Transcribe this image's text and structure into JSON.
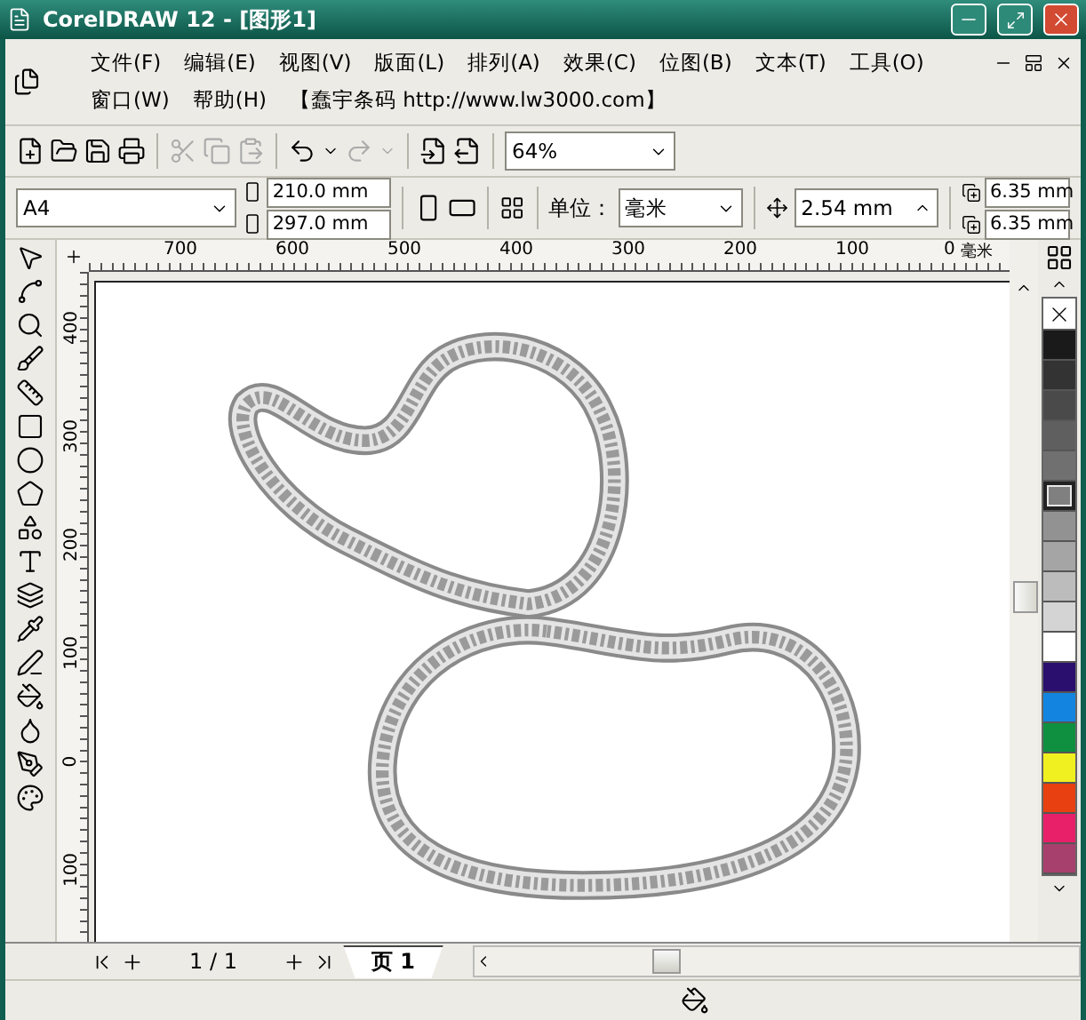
{
  "window": {
    "title": "CorelDRAW 12 - [图形1]"
  },
  "menu": {
    "rows": [
      [
        "文件(F)",
        "编辑(E)",
        "视图(V)",
        "版面(L)",
        "排列(A)",
        "效果(C)",
        "位图(B)",
        "文本(T)",
        "工具(O)"
      ],
      [
        "窗口(W)",
        "帮助(H)",
        "【蠢宇条码 http://www.lw3000.com】"
      ]
    ]
  },
  "toolbar": {
    "zoom": "64%"
  },
  "property_bar": {
    "paper": "A4",
    "width": "210.0 mm",
    "height": "297.0 mm",
    "unit_label": "单位：",
    "unit": "毫米",
    "nudge": "2.54 mm",
    "duplicate_x": "6.35 mm",
    "duplicate_y": "6.35 mm"
  },
  "horizontal_ruler": {
    "ticks": [
      "700",
      "600",
      "500",
      "400",
      "300",
      "200",
      "100",
      "0"
    ],
    "unit": "毫米"
  },
  "vertical_ruler": {
    "ticks": [
      "400",
      "300",
      "200",
      "100",
      "0",
      "100"
    ]
  },
  "palette": [
    {
      "kind": "none",
      "selected": false
    },
    {
      "kind": "color",
      "color": "#1a1a1a",
      "selected": false
    },
    {
      "kind": "color",
      "color": "#333333",
      "selected": false
    },
    {
      "kind": "color",
      "color": "#4a4a4a",
      "selected": false
    },
    {
      "kind": "color",
      "color": "#5f5f5f",
      "selected": false
    },
    {
      "kind": "color",
      "color": "#707070",
      "selected": false
    },
    {
      "kind": "color",
      "color": "#808080",
      "selected": true
    },
    {
      "kind": "color",
      "color": "#929292",
      "selected": false
    },
    {
      "kind": "color",
      "color": "#a5a5a5",
      "selected": false
    },
    {
      "kind": "color",
      "color": "#bcbcbc",
      "selected": false
    },
    {
      "kind": "color",
      "color": "#d4d4d4",
      "selected": false
    },
    {
      "kind": "color",
      "color": "#ffffff",
      "selected": false
    },
    {
      "kind": "color",
      "color": "#2a0f6e",
      "selected": false
    },
    {
      "kind": "color",
      "color": "#1385e0",
      "selected": false
    },
    {
      "kind": "color",
      "color": "#0e9040",
      "selected": false
    },
    {
      "kind": "color",
      "color": "#f0ef20",
      "selected": false
    },
    {
      "kind": "color",
      "color": "#e84010",
      "selected": false
    },
    {
      "kind": "color",
      "color": "#e8206a",
      "selected": false
    },
    {
      "kind": "color",
      "color": "#a8406e",
      "selected": false
    }
  ],
  "page_bar": {
    "counter": "1 / 1",
    "tabs": [
      {
        "label": "页 1",
        "selected": true
      }
    ]
  }
}
